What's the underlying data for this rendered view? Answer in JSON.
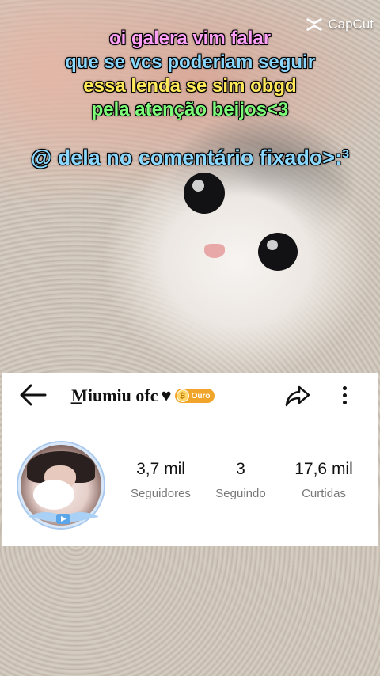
{
  "watermark": {
    "brand": "CapCut",
    "icon": "capcut-logo-icon"
  },
  "overlay": {
    "line1": "oi galera vim falar",
    "line2": "que se vcs poderiam seguir",
    "line3": "essa lenda se sim obgd",
    "line4": "pela atenção beijos<3",
    "line5": "@ dela no comentário fixado>:³"
  },
  "profile": {
    "name": "ㅡ͟Miumiu ofc",
    "heart": "♥",
    "badge": {
      "label": "Ouro",
      "icon": "gold-coin-icon"
    },
    "stats": [
      {
        "value": "3,7 mil",
        "label": "Seguidores"
      },
      {
        "value": "3",
        "label": "Seguindo"
      },
      {
        "value": "17,6 mil",
        "label": "Curtidas"
      }
    ],
    "icons": {
      "back": "back-arrow-icon",
      "share": "share-icon",
      "more": "more-vertical-icon"
    }
  },
  "colors": {
    "badge": "#f0a52a",
    "card": "#ffffff"
  }
}
